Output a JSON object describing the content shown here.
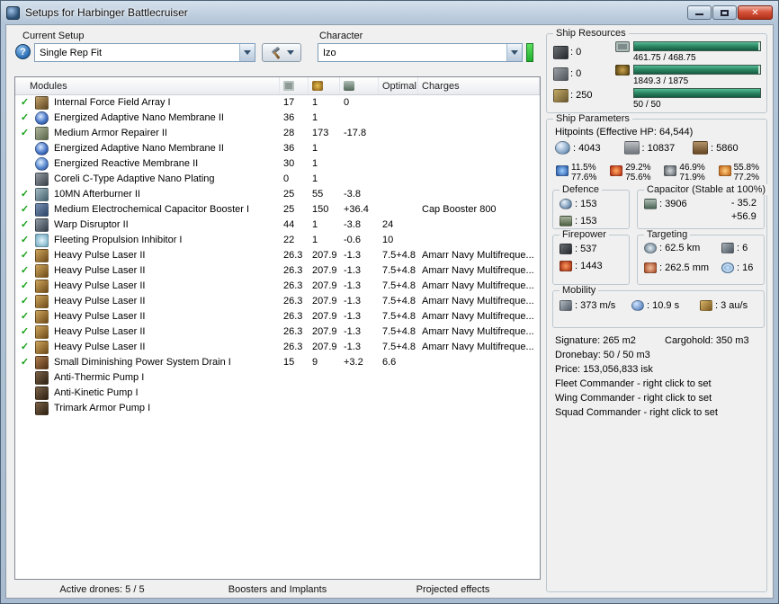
{
  "window": {
    "title": "Setups for Harbinger Battlecruiser"
  },
  "setup": {
    "label": "Current Setup",
    "value": "Single Rep Fit",
    "help_glyph": "?"
  },
  "character": {
    "label": "Character",
    "value": "Izo"
  },
  "modules": {
    "header": {
      "modules": "Modules",
      "optimal": "Optimal",
      "charges": "Charges"
    },
    "rows": [
      {
        "checked": true,
        "icon": "damage-control-icon",
        "name": "Internal Force Field Array I",
        "cpu": "17",
        "pg": "1",
        "cap": "0",
        "optimal": "",
        "charges": ""
      },
      {
        "checked": true,
        "icon": "nano-membrane-icon",
        "name": "Energized Adaptive Nano Membrane II",
        "cpu": "36",
        "pg": "1",
        "cap": "",
        "optimal": "",
        "charges": ""
      },
      {
        "checked": true,
        "icon": "armor-repairer-icon",
        "name": "Medium Armor Repairer II",
        "cpu": "28",
        "pg": "173",
        "cap": "-17.8",
        "optimal": "",
        "charges": ""
      },
      {
        "checked": false,
        "icon": "nano-membrane-icon",
        "name": "Energized Adaptive Nano Membrane II",
        "cpu": "36",
        "pg": "1",
        "cap": "",
        "optimal": "",
        "charges": ""
      },
      {
        "checked": false,
        "icon": "reactive-membrane-icon",
        "name": "Energized Reactive Membrane II",
        "cpu": "30",
        "pg": "1",
        "cap": "",
        "optimal": "",
        "charges": ""
      },
      {
        "checked": false,
        "icon": "nano-plating-icon",
        "name": "Coreli C-Type Adaptive Nano Plating",
        "cpu": "0",
        "pg": "1",
        "cap": "",
        "optimal": "",
        "charges": ""
      },
      {
        "checked": true,
        "icon": "afterburner-icon",
        "name": "10MN Afterburner II",
        "cpu": "25",
        "pg": "55",
        "cap": "-3.8",
        "optimal": "",
        "charges": ""
      },
      {
        "checked": true,
        "icon": "cap-booster-icon",
        "name": "Medium Electrochemical Capacitor Booster I",
        "cpu": "25",
        "pg": "150",
        "cap": "+36.4",
        "optimal": "",
        "charges": "Cap Booster 800"
      },
      {
        "checked": true,
        "icon": "warp-disruptor-icon",
        "name": "Warp Disruptor II",
        "cpu": "44",
        "pg": "1",
        "cap": "-3.8",
        "optimal": "24",
        "charges": ""
      },
      {
        "checked": true,
        "icon": "stasis-web-icon",
        "name": "Fleeting Propulsion Inhibitor I",
        "cpu": "22",
        "pg": "1",
        "cap": "-0.6",
        "optimal": "10",
        "charges": ""
      },
      {
        "checked": true,
        "icon": "pulse-laser-icon",
        "name": "Heavy Pulse Laser II",
        "cpu": "26.3",
        "pg": "207.9",
        "cap": "-1.3",
        "optimal": "7.5+4.8",
        "charges": "Amarr Navy Multifreque..."
      },
      {
        "checked": true,
        "icon": "pulse-laser-icon",
        "name": "Heavy Pulse Laser II",
        "cpu": "26.3",
        "pg": "207.9",
        "cap": "-1.3",
        "optimal": "7.5+4.8",
        "charges": "Amarr Navy Multifreque..."
      },
      {
        "checked": true,
        "icon": "pulse-laser-icon",
        "name": "Heavy Pulse Laser II",
        "cpu": "26.3",
        "pg": "207.9",
        "cap": "-1.3",
        "optimal": "7.5+4.8",
        "charges": "Amarr Navy Multifreque..."
      },
      {
        "checked": true,
        "icon": "pulse-laser-icon",
        "name": "Heavy Pulse Laser II",
        "cpu": "26.3",
        "pg": "207.9",
        "cap": "-1.3",
        "optimal": "7.5+4.8",
        "charges": "Amarr Navy Multifreque..."
      },
      {
        "checked": true,
        "icon": "pulse-laser-icon",
        "name": "Heavy Pulse Laser II",
        "cpu": "26.3",
        "pg": "207.9",
        "cap": "-1.3",
        "optimal": "7.5+4.8",
        "charges": "Amarr Navy Multifreque..."
      },
      {
        "checked": true,
        "icon": "pulse-laser-icon",
        "name": "Heavy Pulse Laser II",
        "cpu": "26.3",
        "pg": "207.9",
        "cap": "-1.3",
        "optimal": "7.5+4.8",
        "charges": "Amarr Navy Multifreque..."
      },
      {
        "checked": true,
        "icon": "pulse-laser-icon",
        "name": "Heavy Pulse Laser II",
        "cpu": "26.3",
        "pg": "207.9",
        "cap": "-1.3",
        "optimal": "7.5+4.8",
        "charges": "Amarr Navy Multifreque..."
      },
      {
        "checked": true,
        "icon": "nosferatu-icon",
        "name": "Small Diminishing Power System Drain I",
        "cpu": "15",
        "pg": "9",
        "cap": "+3.2",
        "optimal": "6.6",
        "charges": ""
      },
      {
        "checked": false,
        "icon": "armor-rig-icon",
        "name": "Anti-Thermic Pump I",
        "cpu": "",
        "pg": "",
        "cap": "",
        "optimal": "",
        "charges": ""
      },
      {
        "checked": false,
        "icon": "armor-rig-icon",
        "name": "Anti-Kinetic Pump I",
        "cpu": "",
        "pg": "",
        "cap": "",
        "optimal": "",
        "charges": ""
      },
      {
        "checked": false,
        "icon": "armor-rig-icon",
        "name": "Trimark Armor Pump I",
        "cpu": "",
        "pg": "",
        "cap": "",
        "optimal": "",
        "charges": ""
      }
    ]
  },
  "bottom_tabs": [
    {
      "label": "Active drones: 5 / 5"
    },
    {
      "label": "Boosters and Implants"
    },
    {
      "label": "Projected effects"
    }
  ],
  "ship_resources": {
    "title": "Ship Resources",
    "turrets": "0",
    "launchers": "0",
    "calibration": "250",
    "bars": [
      {
        "text": "461.75 / 468.75",
        "pct": 98.5
      },
      {
        "text": "1849.3 / 1875",
        "pct": 98.6
      },
      {
        "text": "50 / 50",
        "pct": 100
      }
    ]
  },
  "ship_parameters": {
    "title": "Ship Parameters",
    "hitpoints_label": "Hitpoints (Effective HP: 64,544)",
    "shield_hp": "4043",
    "armor_hp": "10837",
    "hull_hp": "5860",
    "resists": [
      {
        "type": "em",
        "shield": "11.5%",
        "armor": "77.6%"
      },
      {
        "type": "thermal",
        "shield": "29.2%",
        "armor": "75.6%"
      },
      {
        "type": "kinetic",
        "shield": "46.9%",
        "armor": "71.9%"
      },
      {
        "type": "explosive",
        "shield": "55.8%",
        "armor": "77.2%"
      }
    ],
    "defence": {
      "title": "Defence",
      "value1": "153",
      "value2": "153"
    },
    "capacitor": {
      "title": "Capacitor (Stable at 100%)",
      "amount": "3906",
      "usage": "- 35.2",
      "recharge": "+56.9"
    },
    "firepower": {
      "title": "Firepower",
      "volley": "537",
      "dps": "1443"
    },
    "targeting": {
      "title": "Targeting",
      "range": "62.5 km",
      "max_targets": "6",
      "scan_resolution": "262.5 mm",
      "sensor_strength": "16"
    },
    "mobility": {
      "title": "Mobility",
      "speed": "373 m/s",
      "align_time": "10.9 s",
      "warp_speed": "3 au/s"
    },
    "stats": {
      "signature": "Signature: 265 m2",
      "cargohold": "Cargohold: 350 m3",
      "dronebay": "Dronebay: 50 / 50 m3",
      "price": "Price: 153,056,833 isk",
      "fleet": "Fleet Commander - right click to set",
      "wing": "Wing Commander - right click to set",
      "squad": "Squad Commander - right click to set"
    }
  }
}
